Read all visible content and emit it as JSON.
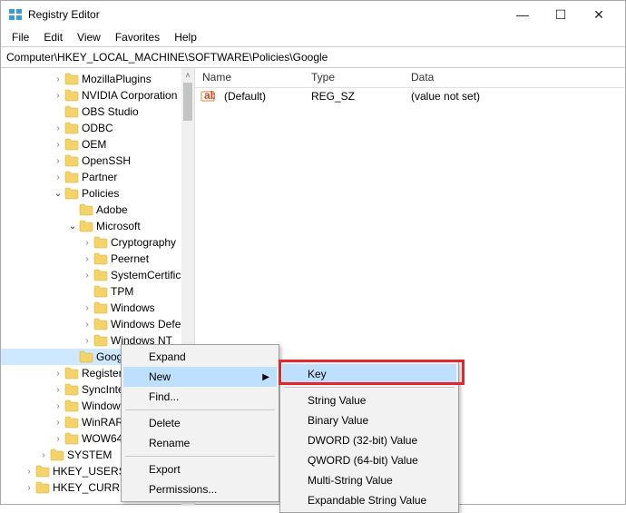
{
  "window": {
    "title": "Registry Editor",
    "min": "—",
    "max": "☐",
    "close": "✕"
  },
  "menu": {
    "file": "File",
    "edit": "Edit",
    "view": "View",
    "favorites": "Favorites",
    "help": "Help"
  },
  "addressbar": {
    "path": "Computer\\HKEY_LOCAL_MACHINE\\SOFTWARE\\Policies\\Google"
  },
  "tree": {
    "scroll_up": "˄",
    "scroll_down": "˅",
    "items": [
      {
        "indent": 56,
        "exp": ">",
        "label": "MozillaPlugins"
      },
      {
        "indent": 56,
        "exp": ">",
        "label": "NVIDIA Corporation"
      },
      {
        "indent": 56,
        "exp": "",
        "label": "OBS Studio"
      },
      {
        "indent": 56,
        "exp": ">",
        "label": "ODBC"
      },
      {
        "indent": 56,
        "exp": ">",
        "label": "OEM"
      },
      {
        "indent": 56,
        "exp": ">",
        "label": "OpenSSH"
      },
      {
        "indent": 56,
        "exp": ">",
        "label": "Partner"
      },
      {
        "indent": 56,
        "exp": "v",
        "label": "Policies"
      },
      {
        "indent": 72,
        "exp": "",
        "label": "Adobe"
      },
      {
        "indent": 72,
        "exp": "v",
        "label": "Microsoft"
      },
      {
        "indent": 88,
        "exp": ">",
        "label": "Cryptography"
      },
      {
        "indent": 88,
        "exp": ">",
        "label": "Peernet"
      },
      {
        "indent": 88,
        "exp": ">",
        "label": "SystemCertific"
      },
      {
        "indent": 88,
        "exp": "",
        "label": "TPM"
      },
      {
        "indent": 88,
        "exp": ">",
        "label": "Windows"
      },
      {
        "indent": 88,
        "exp": ">",
        "label": "Windows Defe"
      },
      {
        "indent": 88,
        "exp": ">",
        "label": "Windows NT"
      },
      {
        "indent": 72,
        "exp": "",
        "label": "Google",
        "selected": true
      },
      {
        "indent": 56,
        "exp": ">",
        "label": "Registered"
      },
      {
        "indent": 56,
        "exp": ">",
        "label": "SyncInte"
      },
      {
        "indent": 56,
        "exp": ">",
        "label": "Window"
      },
      {
        "indent": 56,
        "exp": ">",
        "label": "WinRAR"
      },
      {
        "indent": 56,
        "exp": ">",
        "label": "WOW643"
      },
      {
        "indent": 40,
        "exp": ">",
        "label": "SYSTEM"
      },
      {
        "indent": 24,
        "exp": ">",
        "label": "HKEY_USERS"
      },
      {
        "indent": 24,
        "exp": ">",
        "label": "HKEY_CURREN"
      }
    ]
  },
  "list": {
    "headers": {
      "name": "Name",
      "type": "Type",
      "data": "Data"
    },
    "rows": [
      {
        "name": "(Default)",
        "type": "REG_SZ",
        "data": "(value not set)"
      }
    ]
  },
  "context_menu": {
    "expand": "Expand",
    "new": "New",
    "find": "Find...",
    "delete": "Delete",
    "rename": "Rename",
    "export": "Export",
    "permissions": "Permissions..."
  },
  "submenu": {
    "key": "Key",
    "string": "String Value",
    "binary": "Binary Value",
    "dword": "DWORD (32-bit) Value",
    "qword": "QWORD (64-bit) Value",
    "multi": "Multi-String Value",
    "expandable": "Expandable String Value"
  }
}
